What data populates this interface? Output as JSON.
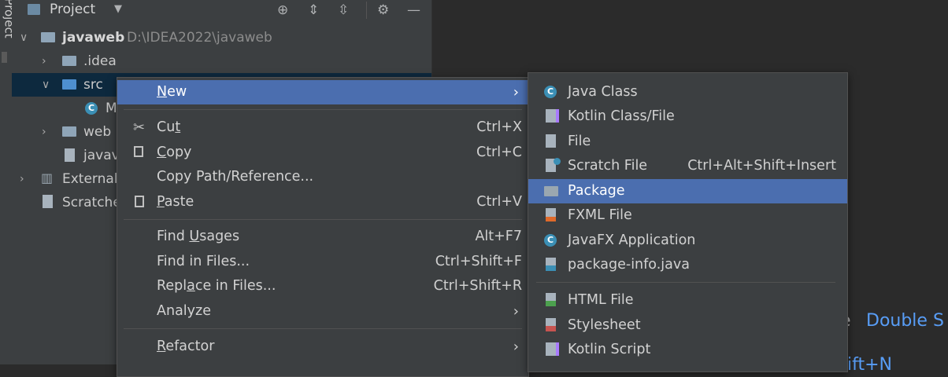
{
  "tool_stripe": {
    "label": "Project"
  },
  "project_panel": {
    "title": "Project",
    "tree": [
      {
        "label": "javaweb",
        "path": "D:\\IDEA2022\\javaweb"
      },
      {
        "label": ".idea"
      },
      {
        "label": "src"
      },
      {
        "label": "M"
      },
      {
        "label": "web"
      },
      {
        "label": "javav"
      },
      {
        "label": "External"
      },
      {
        "label": "Scratche"
      }
    ]
  },
  "context_menu": {
    "items": [
      {
        "label": "New",
        "mnemonic": "N",
        "rest": "ew"
      },
      {
        "pre": "Cu",
        "mnemonic": "t",
        "post": "",
        "shortcut": "Ctrl+X"
      },
      {
        "pre": "",
        "mnemonic": "C",
        "post": "opy",
        "shortcut": "Ctrl+C"
      },
      {
        "label": "Copy Path/Reference..."
      },
      {
        "pre": "",
        "mnemonic": "P",
        "post": "aste",
        "shortcut": "Ctrl+V"
      },
      {
        "pre": "Find ",
        "mnemonic": "U",
        "post": "sages",
        "shortcut": "Alt+F7"
      },
      {
        "label": "Find in Files...",
        "shortcut": "Ctrl+Shift+F"
      },
      {
        "pre": "Repl",
        "mnemonic": "a",
        "post": "ce in Files...",
        "shortcut": "Ctrl+Shift+R"
      },
      {
        "label": "Analyze"
      },
      {
        "pre": "",
        "mnemonic": "R",
        "post": "efactor"
      }
    ]
  },
  "new_submenu": {
    "items": [
      {
        "label": "Java Class"
      },
      {
        "label": "Kotlin Class/File"
      },
      {
        "label": "File"
      },
      {
        "label": "Scratch File",
        "shortcut": "Ctrl+Alt+Shift+Insert"
      },
      {
        "label": "Package"
      },
      {
        "label": "FXML File"
      },
      {
        "label": "JavaFX Application"
      },
      {
        "label": "package-info.java"
      },
      {
        "label": "HTML File"
      },
      {
        "label": "Stylesheet"
      },
      {
        "label": "Kotlin Script"
      }
    ]
  },
  "editor_hint": {
    "prefix": "e",
    "action": "Double S",
    "second": "ift+N"
  },
  "colors": {
    "highlight": "#4b6eaf",
    "background": "#2b2b2b",
    "panel": "#3c3f41",
    "link": "#589df6",
    "selected_row": "#0d293e"
  }
}
